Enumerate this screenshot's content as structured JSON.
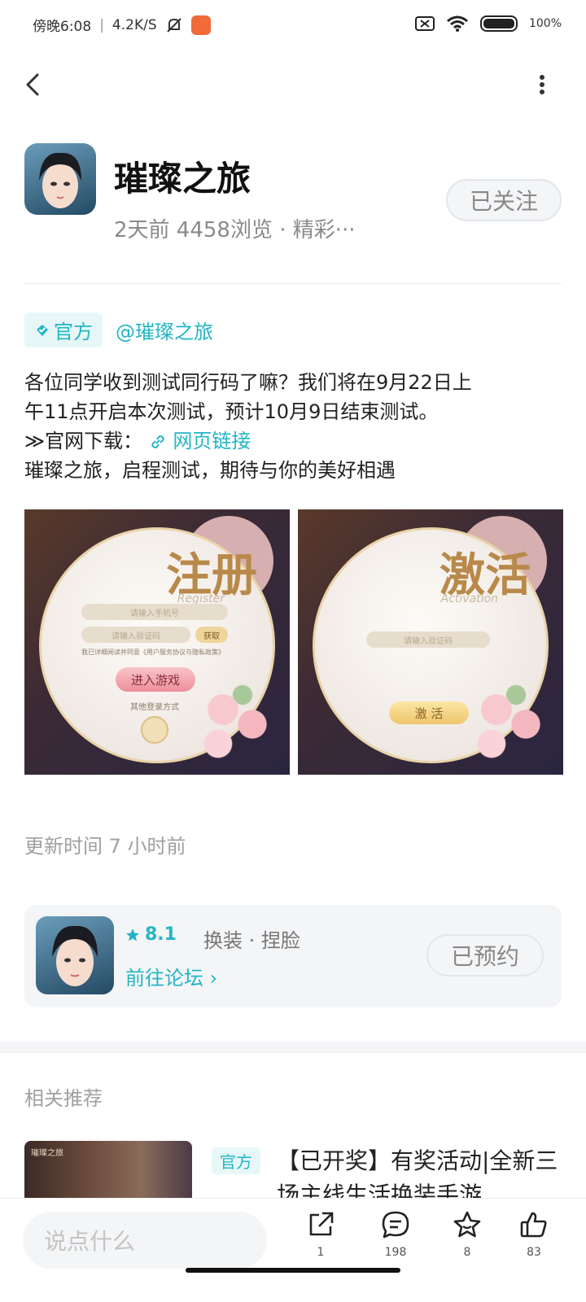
{
  "status_bar": {
    "time": "傍晚6:08",
    "speed": "4.2K/S",
    "battery": "100%"
  },
  "nav": {
    "back_icon": "back-icon",
    "more_icon": "more-vertical-icon"
  },
  "header": {
    "title": "璀璨之旅",
    "meta": "2天前 4458浏览 · 精彩···",
    "follow_label": "已关注"
  },
  "tags": {
    "official": "官方",
    "mention": "@璀璨之旅"
  },
  "post": {
    "line1": "各位同学收到测试同行码了嘛？我们将在9月22日上",
    "line2": "午11点开启本次测试，预计10月9日结束测试。",
    "line3_prefix": "≫官网下载：",
    "line3_link": "网页链接",
    "line4": "璀璨之旅，启程测试，期待与你的美好相遇"
  },
  "images": {
    "register": {
      "title": "注册",
      "subtitle": "Register",
      "phone_placeholder": "请输入手机号",
      "code_placeholder": "请输入验证码",
      "get_code": "获取",
      "agreement": "我已详细阅读并同意《用户服务协议与隐私政策》",
      "enter_game": "进入游戏",
      "other_login": "其他登录方式"
    },
    "activate": {
      "title": "激活",
      "subtitle": "Activation",
      "code_placeholder": "请输入验证码",
      "activate_button": "激 活"
    }
  },
  "update_time": "更新时间 7 小时前",
  "game_card": {
    "rating": "8.1",
    "tags": "换装 · 捏脸",
    "forum_link": "前往论坛 ›",
    "reserve_label": "已预约"
  },
  "related": {
    "title": "相关推荐",
    "thumb_label": "璀璨之旅",
    "tag": "官方",
    "text": "【已开奖】有奖活动|全新三场主线生活换装手游"
  },
  "bottom_bar": {
    "comment_placeholder": "说点什么",
    "share_count": "1",
    "comment_count": "198",
    "favorite_count": "8",
    "like_count": "83"
  },
  "colors": {
    "accent": "#23b5c4",
    "muted": "#8a8a8a"
  }
}
